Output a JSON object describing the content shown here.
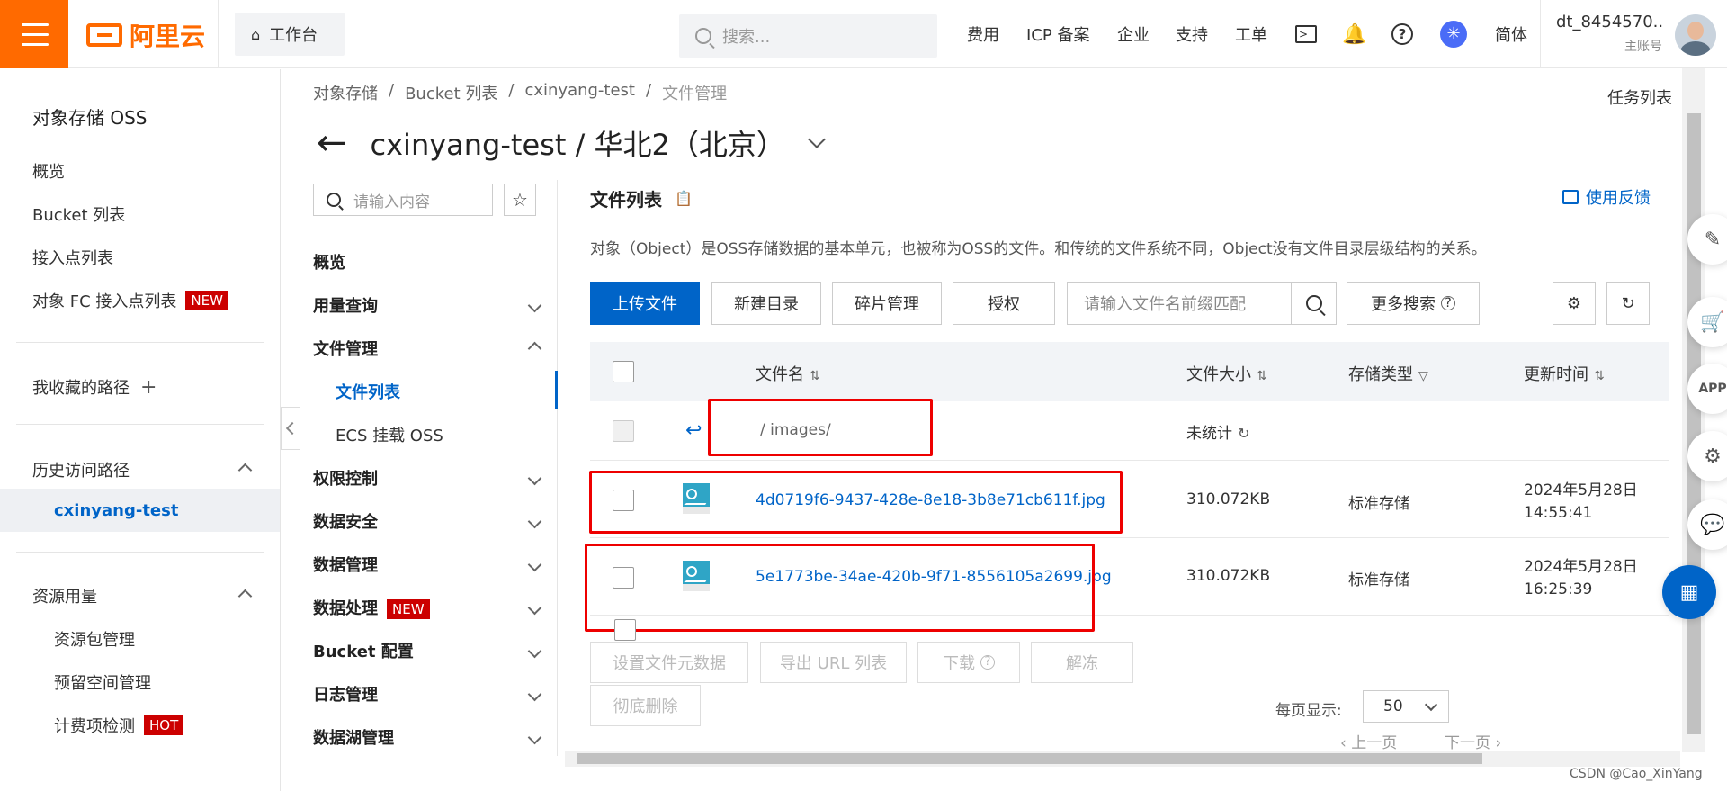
{
  "topbar": {
    "logo_text": "阿里云",
    "workbench": "工作台",
    "search_placeholder": "搜索...",
    "nav": [
      "费用",
      "ICP 备案",
      "企业",
      "支持",
      "工单"
    ],
    "lang": "简体",
    "user_name": "dt_8454570...",
    "user_role": "主账号"
  },
  "sidebar": {
    "title": "对象存储 OSS",
    "items": [
      "概览",
      "Bucket 列表",
      "接入点列表",
      "对象 FC 接入点列表"
    ],
    "new_badge": "NEW",
    "favorites": "我收藏的路径",
    "history": "历史访问路径",
    "history_item": "cxinyang-test",
    "resources": "资源用量",
    "resource_items": [
      "资源包管理",
      "预留空间管理",
      "计费项检测"
    ],
    "hot_badge": "HOT"
  },
  "breadcrumb": [
    "对象存储",
    "Bucket 列表",
    "cxinyang-test",
    "文件管理"
  ],
  "task_list": "任务列表",
  "page_title": "cxinyang-test / 华北2（北京）",
  "mid_menu": {
    "search_placeholder": "请输入内容",
    "items": [
      "概览",
      "用量查询",
      "文件管理",
      "权限控制",
      "数据安全",
      "数据管理",
      "数据处理",
      "Bucket 配置",
      "日志管理",
      "数据湖管理"
    ],
    "sub_items": [
      "文件列表",
      "ECS 挂载 OSS"
    ],
    "new_badge": "NEW"
  },
  "file_list": {
    "title": "文件列表",
    "feedback": "使用反馈",
    "description": "对象（Object）是OSS存储数据的基本单元，也被称为OSS的文件。和传统的文件系统不同，Object没有文件目录层级结构的关系。",
    "buttons": [
      "上传文件",
      "新建目录",
      "碎片管理",
      "授权"
    ],
    "search_placeholder": "请输入文件名前缀匹配",
    "more_search": "更多搜索",
    "columns": [
      "文件名",
      "文件大小",
      "存储类型",
      "更新时间"
    ],
    "folder_row": {
      "path": "/ images/",
      "size": "未统计"
    },
    "rows": [
      {
        "name": "4d0719f6-9437-428e-8e18-3b8e71cb611f.jpg",
        "size": "310.072KB",
        "type": "标准存储",
        "date": "2024年5月28日",
        "time": "14:55:41"
      },
      {
        "name": "5e1773be-34ae-420b-9f71-8556105a2699.jpg",
        "size": "310.072KB",
        "type": "标准存储",
        "date": "2024年5月28日",
        "time": "16:25:39"
      }
    ],
    "bottom_buttons": [
      "设置文件元数据",
      "导出 URL 列表",
      "下载",
      "解冻",
      "彻底删除"
    ],
    "per_page_label": "每页显示:",
    "per_page_value": "50",
    "prev": "上一页",
    "next": "下一页"
  },
  "watermark": "CSDN @Cao_XinYang",
  "colors": {
    "brand": "#ff6a00",
    "primary": "#0064c8",
    "highlight": "#e00000"
  }
}
